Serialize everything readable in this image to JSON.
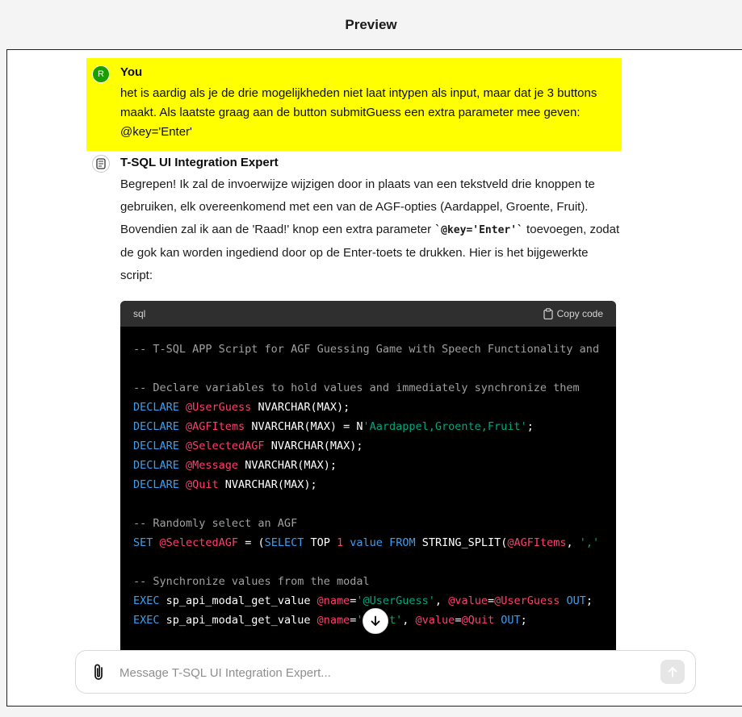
{
  "header": {
    "title": "Preview"
  },
  "user_message": {
    "avatar_initial": "R",
    "author": "You",
    "text": "het is aardig als je de drie mogelijkheden niet laat intypen als input, maar dat je 3 buttons maakt. Als laatste graag aan de button submitGuess een extra parameter mee geven: @key='Enter'"
  },
  "assistant_message": {
    "author": "T-SQL UI Integration Expert",
    "avatar_icon": "bot-icon",
    "text_before_code": "Begrepen! Ik zal de invoerwijze wijzigen door in plaats van een tekstveld drie knoppen te gebruiken, elk overeenkomend met een van de AGF-opties (Aardappel, Groente, Fruit). Bovendien zal ik aan de 'Raad!' knop een extra parameter ",
    "inline_code": "`@key='Enter'`",
    "text_after_code": " toevoegen, zodat de gok kan worden ingediend door op de Enter-toets te drukken. Hier is het bijgewerkte script:"
  },
  "code_block": {
    "language": "sql",
    "copy_label": "Copy code",
    "lines": [
      [
        {
          "t": "-- T-SQL APP Script for AGF Guessing Game with Speech Functionality and",
          "c": "com"
        }
      ],
      [],
      [
        {
          "t": "-- Declare variables to hold values and immediately synchronize them",
          "c": "com"
        }
      ],
      [
        {
          "t": "DECLARE ",
          "c": "kw"
        },
        {
          "t": "@UserGuess",
          "c": "var"
        },
        {
          "t": " NVARCHAR(MAX);",
          "c": "txt"
        }
      ],
      [
        {
          "t": "DECLARE ",
          "c": "kw"
        },
        {
          "t": "@AGFItems",
          "c": "var"
        },
        {
          "t": " NVARCHAR(MAX) = N",
          "c": "txt"
        },
        {
          "t": "'Aardappel,Groente,Fruit'",
          "c": "str"
        },
        {
          "t": ";",
          "c": "txt"
        }
      ],
      [
        {
          "t": "DECLARE ",
          "c": "kw"
        },
        {
          "t": "@SelectedAGF",
          "c": "var"
        },
        {
          "t": " NVARCHAR(MAX);",
          "c": "txt"
        }
      ],
      [
        {
          "t": "DECLARE ",
          "c": "kw"
        },
        {
          "t": "@Message",
          "c": "var"
        },
        {
          "t": " NVARCHAR(MAX);",
          "c": "txt"
        }
      ],
      [
        {
          "t": "DECLARE ",
          "c": "kw"
        },
        {
          "t": "@Quit",
          "c": "var"
        },
        {
          "t": " NVARCHAR(MAX);",
          "c": "txt"
        }
      ],
      [],
      [
        {
          "t": "-- Randomly select an AGF",
          "c": "com"
        }
      ],
      [
        {
          "t": "SET ",
          "c": "kw"
        },
        {
          "t": "@SelectedAGF",
          "c": "var"
        },
        {
          "t": " = (",
          "c": "txt"
        },
        {
          "t": "SELECT",
          "c": "kw"
        },
        {
          "t": " TOP ",
          "c": "txt"
        },
        {
          "t": "1",
          "c": "var"
        },
        {
          "t": " ",
          "c": "txt"
        },
        {
          "t": "value",
          "c": "kw"
        },
        {
          "t": " ",
          "c": "txt"
        },
        {
          "t": "FROM",
          "c": "kw"
        },
        {
          "t": " STRING_SPLIT(",
          "c": "txt"
        },
        {
          "t": "@AGFItems",
          "c": "var"
        },
        {
          "t": ", ",
          "c": "txt"
        },
        {
          "t": "','",
          "c": "str"
        }
      ],
      [],
      [
        {
          "t": "-- Synchronize values from the modal",
          "c": "com"
        }
      ],
      [
        {
          "t": "EXEC",
          "c": "kw"
        },
        {
          "t": " sp_api_modal_get_value ",
          "c": "txt"
        },
        {
          "t": "@name",
          "c": "var"
        },
        {
          "t": "=",
          "c": "txt"
        },
        {
          "t": "'@UserGuess'",
          "c": "str"
        },
        {
          "t": ", ",
          "c": "txt"
        },
        {
          "t": "@value",
          "c": "var"
        },
        {
          "t": "=",
          "c": "txt"
        },
        {
          "t": "@UserGuess",
          "c": "var"
        },
        {
          "t": " ",
          "c": "txt"
        },
        {
          "t": "OUT",
          "c": "kw"
        },
        {
          "t": ";",
          "c": "txt"
        }
      ],
      [
        {
          "t": "EXEC",
          "c": "kw"
        },
        {
          "t": " sp_api_modal_get_value ",
          "c": "txt"
        },
        {
          "t": "@name",
          "c": "var"
        },
        {
          "t": "=",
          "c": "txt"
        },
        {
          "t": "'@Quit'",
          "c": "str"
        },
        {
          "t": ", ",
          "c": "txt"
        },
        {
          "t": "@value",
          "c": "var"
        },
        {
          "t": "=",
          "c": "txt"
        },
        {
          "t": "@Quit",
          "c": "var"
        },
        {
          "t": " ",
          "c": "txt"
        },
        {
          "t": "OUT",
          "c": "kw"
        },
        {
          "t": ";",
          "c": "txt"
        }
      ]
    ]
  },
  "composer": {
    "placeholder": "Message T-SQL UI Integration Expert...",
    "value": ""
  },
  "colors": {
    "user_highlight": "#ffff00",
    "user_avatar": "#19a000",
    "code_comment": "#a0a0a0",
    "code_keyword": "#3b9ef0",
    "code_variable": "#ff3d6e",
    "code_string": "#00a67d"
  },
  "icons": {
    "copy": "clipboard-icon",
    "scroll": "arrow-down-icon",
    "attach": "paperclip-icon",
    "send": "arrow-up-icon"
  }
}
